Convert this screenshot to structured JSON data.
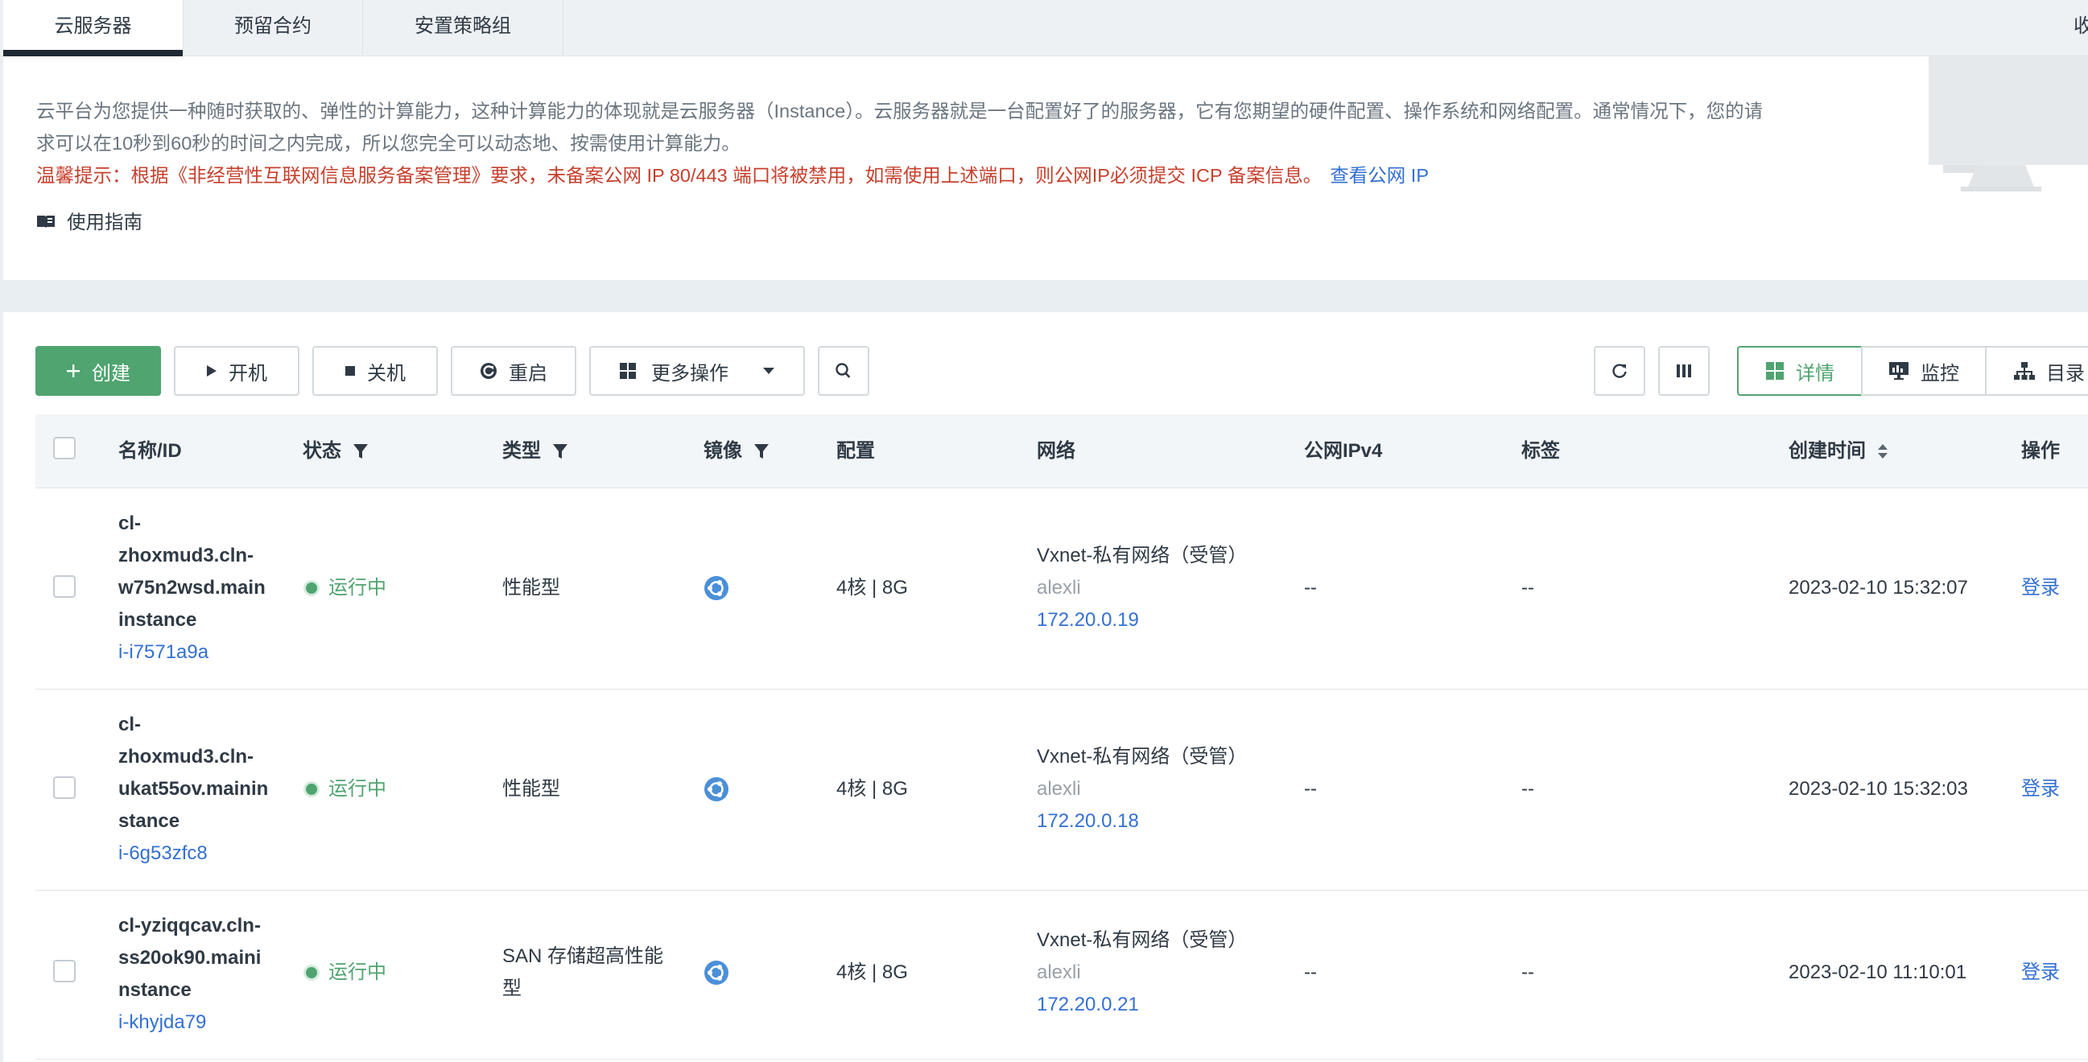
{
  "tabs": [
    {
      "label": "云服务器"
    },
    {
      "label": "预留合约"
    },
    {
      "label": "安置策略组"
    }
  ],
  "collapse_label": "收",
  "intro": {
    "desc_line1": "云平台为您提供一种随时获取的、弹性的计算能力，这种计算能力的体现就是云服务器（Instance）。云服务器就是一台配置好了的服务器，它有您期望的硬件配置、操作系统和网络配置。通常情况下，您的请",
    "desc_line2": "求可以在10秒到60秒的时间之内完成，所以您完全可以动态地、按需使用计算能力。",
    "warning": "温馨提示：根据《非经营性互联网信息服务备案管理》要求，未备案公网 IP 80/443 端口将被禁用，如需使用上述端口，则公网IP必须提交 ICP 备案信息。",
    "warning_link": "查看公网 IP",
    "guide_label": "使用指南"
  },
  "toolbar": {
    "create": "创建",
    "start": "开机",
    "stop": "关机",
    "restart": "重启",
    "more": "更多操作",
    "details": "详情",
    "monitor": "监控",
    "catalog": "目录"
  },
  "columns": {
    "name": "名称/ID",
    "status": "状态",
    "type": "类型",
    "image": "镜像",
    "config": "配置",
    "network": "网络",
    "ipv4": "公网IPv4",
    "tags": "标签",
    "created": "创建时间",
    "actions": "操作"
  },
  "rows": [
    {
      "name_lines": [
        "cl-",
        "zhoxmud3.cln-",
        "w75n2wsd.main",
        "instance"
      ],
      "id": "i-i7571a9a",
      "status": "运行中",
      "type": "性能型",
      "config": "4核 | 8G",
      "network_name": "Vxnet-私有网络（受管）",
      "network_user": "alexli",
      "network_ip": "172.20.0.19",
      "ipv4": "--",
      "tags": "--",
      "created": "2023-02-10 15:32:07",
      "action": "登录"
    },
    {
      "name_lines": [
        "cl-",
        "zhoxmud3.cln-",
        "ukat55ov.mainin",
        "stance"
      ],
      "id": "i-6g53zfc8",
      "status": "运行中",
      "type": "性能型",
      "config": "4核 | 8G",
      "network_name": "Vxnet-私有网络（受管）",
      "network_user": "alexli",
      "network_ip": "172.20.0.18",
      "ipv4": "--",
      "tags": "--",
      "created": "2023-02-10 15:32:03",
      "action": "登录"
    },
    {
      "name_lines": [
        "cl-yziqqcav.cln-",
        "ss20ok90.maini",
        "nstance"
      ],
      "id": "i-khyjda79",
      "status": "运行中",
      "type_lines": [
        "SAN 存储超高性能",
        "型"
      ],
      "config": "4核 | 8G",
      "network_name": "Vxnet-私有网络（受管）",
      "network_user": "alexli",
      "network_ip": "172.20.0.21",
      "ipv4": "--",
      "tags": "--",
      "created": "2023-02-10 11:10:01",
      "action": "登录"
    }
  ],
  "colors": {
    "accent": "#4fa46f",
    "link": "#3370d2",
    "warning": "#c7402d"
  }
}
